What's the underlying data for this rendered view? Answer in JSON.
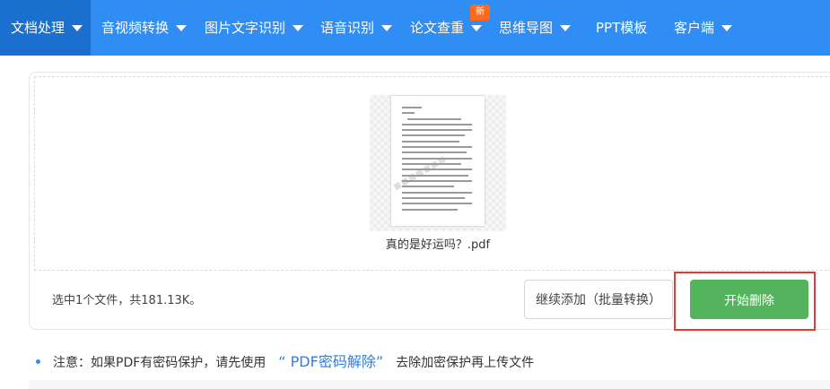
{
  "nav": {
    "items": [
      {
        "label": "文档处理",
        "has_dropdown": true,
        "active": true
      },
      {
        "label": "音视频转换",
        "has_dropdown": true
      },
      {
        "label": "图片文字识别",
        "has_dropdown": true
      },
      {
        "label": "语音识别",
        "has_dropdown": true
      },
      {
        "label": "论文查重",
        "has_dropdown": true,
        "badge": "新"
      },
      {
        "label": "思维导图",
        "has_dropdown": true
      },
      {
        "label": "PPT模板",
        "has_dropdown": false
      },
      {
        "label": "客户端",
        "has_dropdown": true
      }
    ],
    "colors": {
      "bar": "#2f8df3",
      "active": "#1b6fcf",
      "badge": "#ff6a1a"
    }
  },
  "file": {
    "name": "真的是好运吗？.pdf"
  },
  "summary": "选中1个文件，共181.13K。",
  "buttons": {
    "continue_label": "继续添加（批量转换）",
    "start_label": "开始删除",
    "start_color": "#54b45d",
    "highlight_color": "#e53935"
  },
  "note": {
    "prefix": "注意：如果PDF有密码保护，请先使用",
    "link": "“ PDF密码解除”",
    "suffix": "去除加密保护再上传文件"
  }
}
